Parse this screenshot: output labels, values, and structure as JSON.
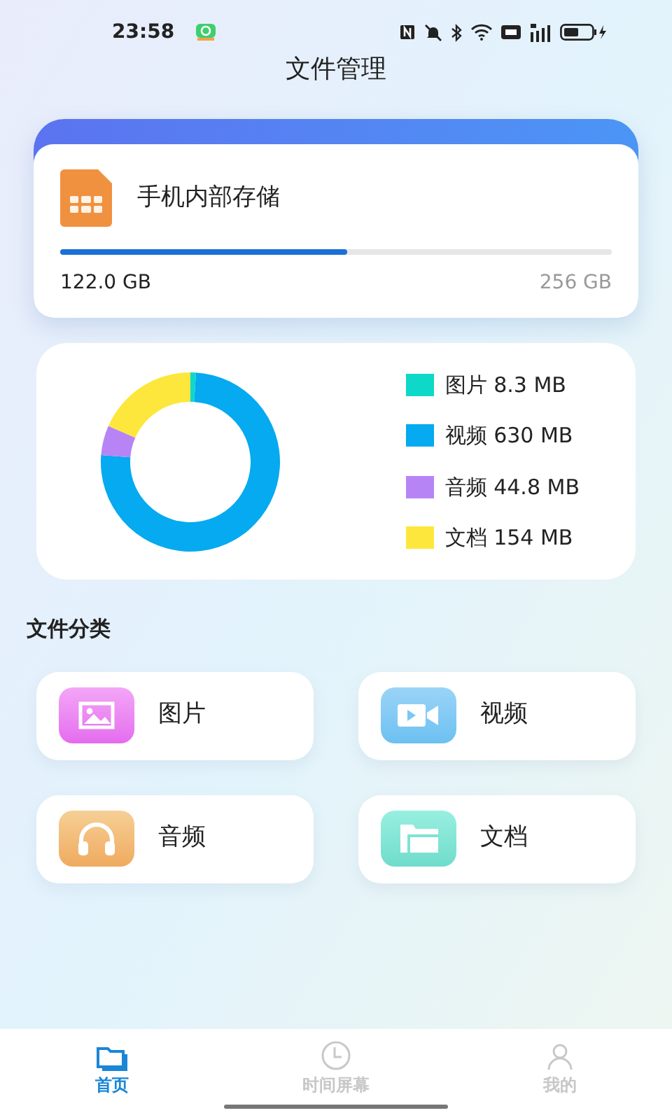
{
  "status_bar": {
    "time": "23:58"
  },
  "title": "文件管理",
  "storage": {
    "name": "手机内部存储",
    "level": 0.52,
    "used": "122.0 GB",
    "total": "256 GB"
  },
  "usage": {
    "chart_data": {
      "type": "donut",
      "categories": [
        "图片",
        "视频",
        "音频",
        "文档"
      ],
      "values": [
        0.99,
        75.26,
        5.35,
        18.4
      ]
    },
    "legend": [
      {
        "value": "8.3 MB",
        "color": "#0ed8c8"
      },
      {
        "value": "630 MB",
        "color": "#05aaf0"
      },
      {
        "value": "44.8 MB",
        "color": "#b784f6"
      },
      {
        "value": "154 MB",
        "color": "#fde73c"
      }
    ]
  },
  "section_title": "文件分类",
  "categories": [
    {
      "kind": "image",
      "label": "图片"
    },
    {
      "kind": "video",
      "label": "视频"
    },
    {
      "kind": "audio",
      "label": "音频"
    },
    {
      "kind": "document",
      "label": "文档"
    }
  ],
  "tabs": [
    {
      "kind": "home",
      "label": "首页",
      "selected": true
    },
    {
      "kind": "clock",
      "label": "时间屏幕",
      "selected": false
    },
    {
      "kind": "person",
      "label": "我的",
      "selected": false
    }
  ]
}
